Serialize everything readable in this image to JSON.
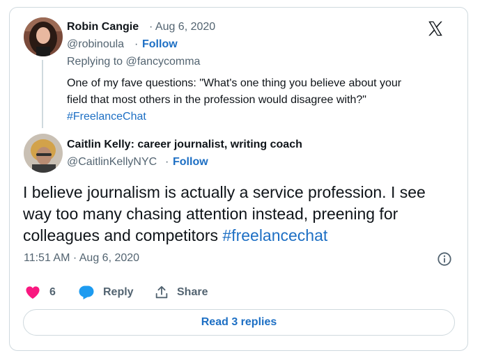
{
  "parent_tweet": {
    "author_name": "Robin Cangie",
    "date": "· Aug 6, 2020",
    "handle": "@robinoula",
    "separator": "·",
    "follow_label": "Follow",
    "replying_prefix": "Replying to",
    "replying_to": "@fancycomma",
    "text_line1": "One of my fave questions: \"What's one thing you believe about your",
    "text_line2": "field that most others in the profession would disagree with?\"",
    "hashtag": "#FreelanceChat"
  },
  "main_tweet": {
    "author_name": "Caitlin Kelly: career journalist, writing coach",
    "handle": "@CaitlinKellyNYC",
    "separator": "·",
    "follow_label": "Follow",
    "text": "I believe journalism is actually a service profession. I see way too many chasing attention instead, preening for colleagues and competitors",
    "hashtag": "#freelancechat",
    "timestamp": "11:51 AM · Aug 6, 2020"
  },
  "actions": {
    "like_count": "6",
    "reply_label": "Reply",
    "share_label": "Share"
  },
  "read_replies_label": "Read 3 replies",
  "colors": {
    "accent": "#1d6fc4",
    "like": "#f91880",
    "reply_icon": "#1d9bf0",
    "muted": "#536471",
    "border": "#cfd9de"
  },
  "icons": [
    "x-logo-icon",
    "info-icon",
    "heart-icon",
    "reply-bubble-icon",
    "share-icon"
  ]
}
